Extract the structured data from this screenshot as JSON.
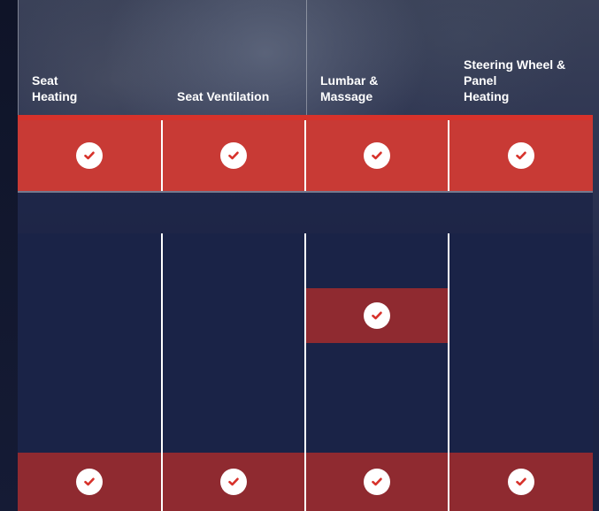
{
  "columns": [
    {
      "label": "Seat\nHeating"
    },
    {
      "label": "Seat Ventilation"
    },
    {
      "label": "Lumbar &\nMassage"
    },
    {
      "label": "Steering Wheel &\nPanel\nHeating"
    }
  ],
  "rows": [
    {
      "style": "red1",
      "checks": [
        true,
        true,
        true,
        true
      ]
    },
    {
      "style": "clear",
      "checks": [
        false,
        false,
        false,
        false
      ]
    },
    {
      "style": "navy",
      "checks": [
        false,
        false,
        false,
        false
      ]
    },
    {
      "style": "navy",
      "checks": [
        false,
        false,
        true,
        false
      ]
    },
    {
      "style": "navy",
      "checks": [
        false,
        false,
        false,
        false
      ]
    },
    {
      "style": "navy",
      "checks": [
        false,
        false,
        false,
        false
      ]
    },
    {
      "style": "red2",
      "checks": [
        true,
        true,
        true,
        true
      ]
    }
  ],
  "colors": {
    "accent_red": "#d7322b",
    "row_red": "#c83a35",
    "row_dark_red": "#8f2a30",
    "row_navy": "#1a2347",
    "check_mark": "#d7322b"
  },
  "icons": {
    "check": "check-circle-icon"
  }
}
